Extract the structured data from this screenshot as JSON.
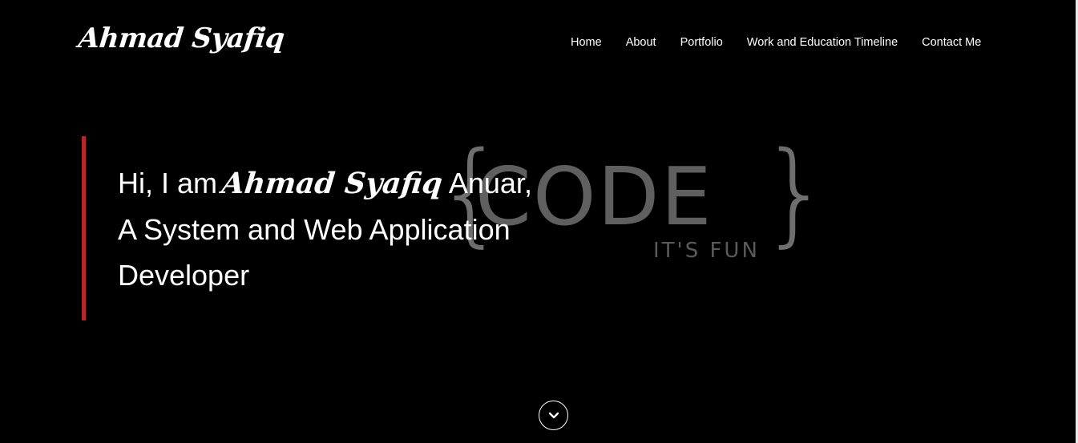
{
  "header": {
    "brand": "Ahmad Syafiq",
    "nav": [
      {
        "label": "Home"
      },
      {
        "label": "About"
      },
      {
        "label": "Portfolio"
      },
      {
        "label": "Work and Education Timeline"
      },
      {
        "label": "Contact Me"
      }
    ]
  },
  "background_graphic": {
    "open_brace": "{",
    "word": "CODE",
    "close_brace": "}",
    "tagline": "IT'S FUN"
  },
  "hero": {
    "greeting_prefix": "Hi, I am",
    "name_script": "Ahmad Syafiq",
    "name_suffix": "Anuar,",
    "line2": "A System and Web Application",
    "line3": "Developer"
  },
  "colors": {
    "background": "#000000",
    "accent_bar": "#b3262a",
    "text": "#ffffff"
  },
  "icons": {
    "scroll_down": "chevron-down-icon"
  }
}
